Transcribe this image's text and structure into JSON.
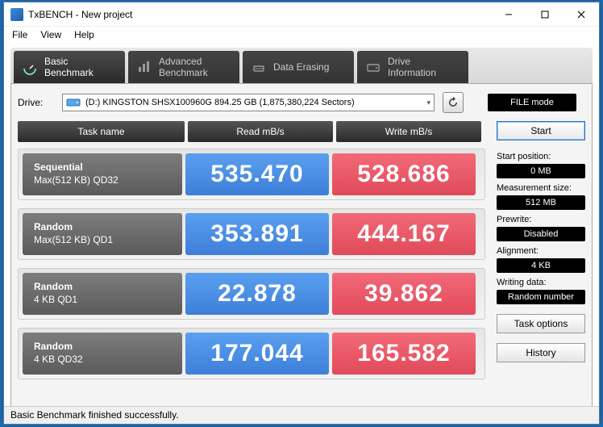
{
  "window": {
    "title": "TxBENCH - New project"
  },
  "menu": {
    "file": "File",
    "view": "View",
    "help": "Help"
  },
  "tabs": {
    "basic": {
      "line1": "Basic",
      "line2": "Benchmark"
    },
    "advanced": {
      "line1": "Advanced",
      "line2": "Benchmark"
    },
    "erase": {
      "line1": "Data Erasing",
      "line2": ""
    },
    "drive": {
      "line1": "Drive",
      "line2": "Information"
    }
  },
  "drive": {
    "label": "Drive:",
    "selected": "(D:) KINGSTON SHSX100960G  894.25 GB (1,875,380,224 Sectors)"
  },
  "filemode": "FILE mode",
  "headers": {
    "task": "Task name",
    "read": "Read mB/s",
    "write": "Write mB/s"
  },
  "rows": [
    {
      "t1": "Sequential",
      "t2": "Max(512 KB) QD32",
      "read": "535.470",
      "write": "528.686"
    },
    {
      "t1": "Random",
      "t2": "Max(512 KB) QD1",
      "read": "353.891",
      "write": "444.167"
    },
    {
      "t1": "Random",
      "t2": "4 KB QD1",
      "read": "22.878",
      "write": "39.862"
    },
    {
      "t1": "Random",
      "t2": "4 KB QD32",
      "read": "177.044",
      "write": "165.582"
    }
  ],
  "sidebar": {
    "start": "Start",
    "startpos_lbl": "Start position:",
    "startpos_val": "0 MB",
    "msize_lbl": "Measurement size:",
    "msize_val": "512 MB",
    "prewrite_lbl": "Prewrite:",
    "prewrite_val": "Disabled",
    "align_lbl": "Alignment:",
    "align_val": "4 KB",
    "wdata_lbl": "Writing data:",
    "wdata_val": "Random number",
    "taskopt": "Task options",
    "history": "History"
  },
  "status": "Basic Benchmark finished successfully."
}
